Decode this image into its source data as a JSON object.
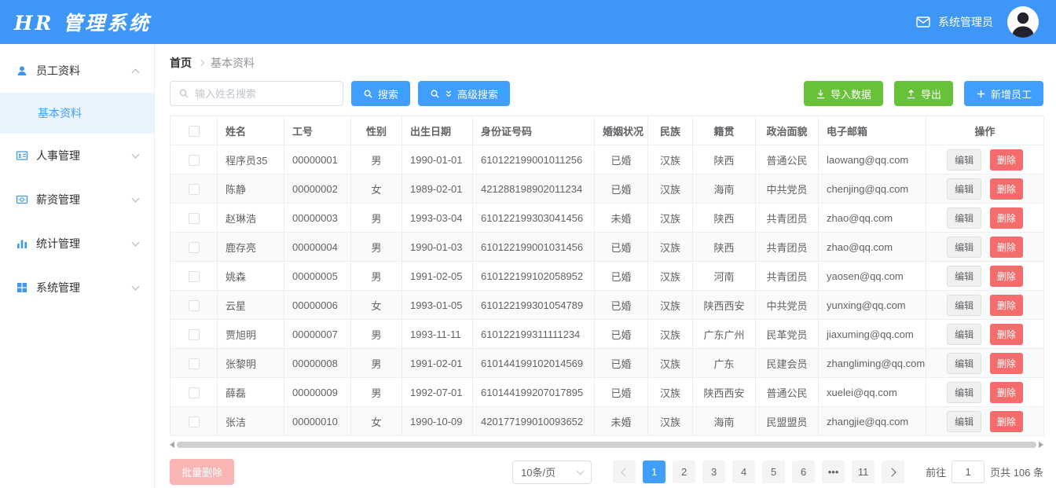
{
  "header": {
    "title": "HR 管理系统",
    "user": "系统管理员"
  },
  "sidebar": {
    "items": [
      {
        "label": "员工资料",
        "icon": "user-icon",
        "expanded": true
      },
      {
        "label": "人事管理",
        "icon": "id-card-icon",
        "expanded": false
      },
      {
        "label": "薪资管理",
        "icon": "money-icon",
        "expanded": false
      },
      {
        "label": "统计管理",
        "icon": "bar-chart-icon",
        "expanded": false
      },
      {
        "label": "系统管理",
        "icon": "windows-icon",
        "expanded": false
      }
    ],
    "sub_item": {
      "label": "基本资料",
      "active": true
    }
  },
  "breadcrumb": {
    "home": "首页",
    "current": "基本资料"
  },
  "toolbar": {
    "search_placeholder": "输入姓名搜索",
    "search_label": "搜索",
    "advanced_search_label": "高级搜索",
    "import_label": "导入数据",
    "export_label": "导出",
    "add_label": "新增员工"
  },
  "table": {
    "columns": [
      "姓名",
      "工号",
      "性别",
      "出生日期",
      "身份证号码",
      "婚姻状况",
      "民族",
      "籍贯",
      "政治面貌",
      "电子邮箱",
      "操作"
    ],
    "edit_label": "编辑",
    "delete_label": "删除",
    "rows": [
      {
        "name": "程序员35",
        "id": "00000001",
        "gender": "男",
        "birth": "1990-01-01",
        "idcard": "610122199001011256",
        "marital": "已婚",
        "ethnicity": "汉族",
        "origin": "陕西",
        "political": "普通公民",
        "email": "laowang@qq.com"
      },
      {
        "name": "陈静",
        "id": "00000002",
        "gender": "女",
        "birth": "1989-02-01",
        "idcard": "421288198902011234",
        "marital": "已婚",
        "ethnicity": "汉族",
        "origin": "海南",
        "political": "中共党员",
        "email": "chenjing@qq.com"
      },
      {
        "name": "赵琳浩",
        "id": "00000003",
        "gender": "男",
        "birth": "1993-03-04",
        "idcard": "610122199303041456",
        "marital": "未婚",
        "ethnicity": "汉族",
        "origin": "陕西",
        "political": "共青团员",
        "email": "zhao@qq.com"
      },
      {
        "name": "鹿存亮",
        "id": "00000004",
        "gender": "男",
        "birth": "1990-01-03",
        "idcard": "610122199001031456",
        "marital": "已婚",
        "ethnicity": "汉族",
        "origin": "陕西",
        "political": "共青团员",
        "email": "zhao@qq.com"
      },
      {
        "name": "姚森",
        "id": "00000005",
        "gender": "男",
        "birth": "1991-02-05",
        "idcard": "610122199102058952",
        "marital": "已婚",
        "ethnicity": "汉族",
        "origin": "河南",
        "political": "共青团员",
        "email": "yaosen@qq.com"
      },
      {
        "name": "云星",
        "id": "00000006",
        "gender": "女",
        "birth": "1993-01-05",
        "idcard": "610122199301054789",
        "marital": "已婚",
        "ethnicity": "汉族",
        "origin": "陕西西安",
        "political": "中共党员",
        "email": "yunxing@qq.com"
      },
      {
        "name": "贾旭明",
        "id": "00000007",
        "gender": "男",
        "birth": "1993-11-11",
        "idcard": "610122199311111234",
        "marital": "已婚",
        "ethnicity": "汉族",
        "origin": "广东广州",
        "political": "民革党员",
        "email": "jiaxuming@qq.com"
      },
      {
        "name": "张黎明",
        "id": "00000008",
        "gender": "男",
        "birth": "1991-02-01",
        "idcard": "610144199102014569",
        "marital": "已婚",
        "ethnicity": "汉族",
        "origin": "广东",
        "political": "民建会员",
        "email": "zhangliming@qq.com"
      },
      {
        "name": "薛磊",
        "id": "00000009",
        "gender": "男",
        "birth": "1992-07-01",
        "idcard": "610144199207017895",
        "marital": "已婚",
        "ethnicity": "汉族",
        "origin": "陕西西安",
        "political": "普通公民",
        "email": "xuelei@qq.com"
      },
      {
        "name": "张洁",
        "id": "00000010",
        "gender": "女",
        "birth": "1990-10-09",
        "idcard": "420177199010093652",
        "marital": "未婚",
        "ethnicity": "汉族",
        "origin": "海南",
        "political": "民盟盟员",
        "email": "zhangjie@qq.com"
      }
    ]
  },
  "footer": {
    "batch_delete_label": "批量删除",
    "page_size": "10条/页",
    "pages": [
      "1",
      "2",
      "3",
      "4",
      "5",
      "6",
      "•••",
      "11"
    ],
    "active_page": "1",
    "ellipsis": "•••",
    "goto_label": "前往",
    "goto_value": "1",
    "total_label": "页共 106 条"
  },
  "colors": {
    "primary": "#409EFF",
    "header_blue": "#3e97f6",
    "success_green": "#67C23A",
    "danger_red": "#F56C6C",
    "disabled_pink": "#f9b4b4",
    "sidebar_active_bg": "#e9f4fe",
    "table_border": "#ebeef5"
  }
}
